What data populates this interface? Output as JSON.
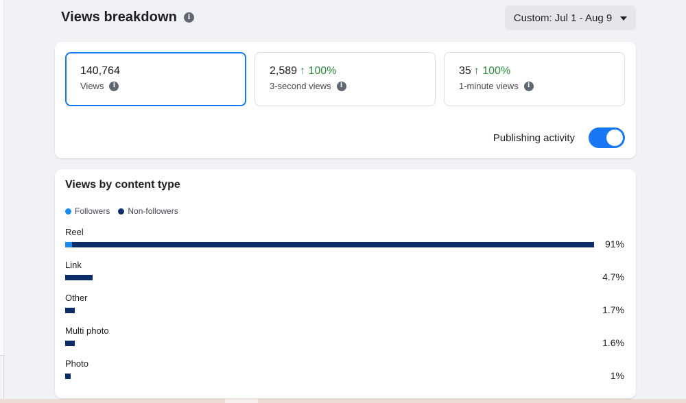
{
  "header": {
    "title": "Views breakdown"
  },
  "date_range": {
    "label": "Custom: Jul 1 - Aug 9"
  },
  "metrics": [
    {
      "value": "140,764",
      "delta": "",
      "label": "Views",
      "selected": true
    },
    {
      "value": "2,589",
      "delta": "↑ 100%",
      "label": "3-second views",
      "selected": false
    },
    {
      "value": "35",
      "delta": "↑ 100%",
      "label": "1-minute views",
      "selected": false
    }
  ],
  "publishing_activity": {
    "label": "Publishing activity",
    "enabled": true
  },
  "content_type": {
    "title": "Views by content type",
    "legend": [
      {
        "label": "Followers",
        "color": "#1b8af0"
      },
      {
        "label": "Non-followers",
        "color": "#0b2e6b"
      }
    ],
    "rows": [
      {
        "label": "Reel",
        "pct_label": "91%",
        "total": 0.91,
        "followers": 0.012
      },
      {
        "label": "Link",
        "pct_label": "4.7%",
        "total": 0.047,
        "followers": 0
      },
      {
        "label": "Other",
        "pct_label": "1.7%",
        "total": 0.017,
        "followers": 0
      },
      {
        "label": "Multi photo",
        "pct_label": "1.6%",
        "total": 0.016,
        "followers": 0
      },
      {
        "label": "Photo",
        "pct_label": "1%",
        "total": 0.01,
        "followers": 0
      }
    ]
  },
  "icons": {
    "info": "info-icon",
    "dropdown": "caret-down-icon"
  }
}
